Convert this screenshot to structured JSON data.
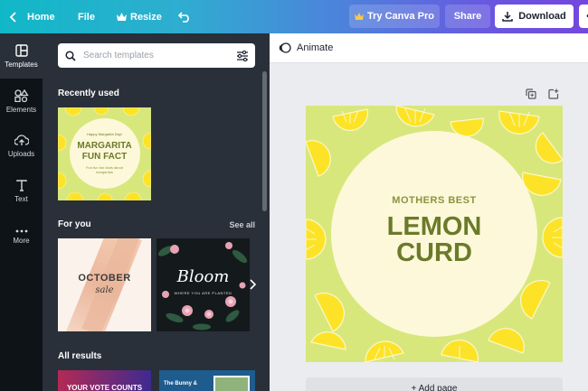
{
  "topbar": {
    "home": "Home",
    "file": "File",
    "resize": "Resize",
    "try_pro": "Try Canva Pro",
    "share": "Share",
    "download": "Download",
    "crown_color": "#f7c948"
  },
  "rail": {
    "items": [
      {
        "label": "Templates",
        "icon": "templates-icon"
      },
      {
        "label": "Elements",
        "icon": "elements-icon"
      },
      {
        "label": "Uploads",
        "icon": "uploads-icon"
      },
      {
        "label": "Text",
        "icon": "text-icon"
      },
      {
        "label": "More",
        "icon": "more-icon"
      }
    ]
  },
  "panel": {
    "search_placeholder": "Search templates",
    "recently_used": "Recently used",
    "for_you": "For you",
    "see_all": "See all",
    "all_results": "All results",
    "recent_template": {
      "small": "Happy Margarita Day!",
      "title_1": "MARGARITA",
      "title_2": "FUN FACT",
      "body": "Fun fun fun facts about margaritas"
    },
    "foryou_1": {
      "title": "OCTOBER",
      "script": "sale"
    },
    "foryou_2": {
      "title": "Bloom",
      "subtitle": "WHERE YOU ARE PLANTED"
    },
    "results": [
      {
        "text": "YOUR VOTE COUNTS"
      },
      {
        "text": "The Bunny &"
      }
    ]
  },
  "editor": {
    "animate": "Animate",
    "design": {
      "kicker": "MOTHERS BEST",
      "title_1": "LEMON",
      "title_2": "CURD"
    },
    "add_page": "+ Add page"
  },
  "colors": {
    "lemon_bg": "#d8e77c",
    "circle": "#fdf8d9",
    "title": "#6b7a2a",
    "lemon": "#fde327"
  }
}
